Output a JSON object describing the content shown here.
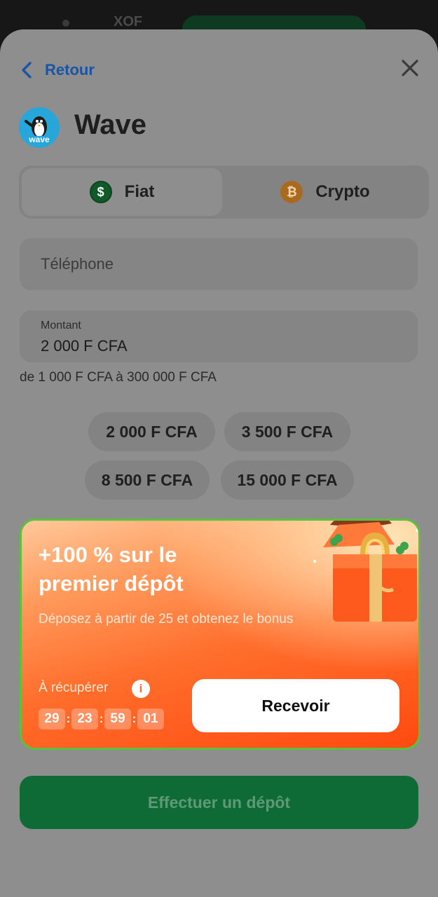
{
  "background": {
    "currency_label": "XOF"
  },
  "header": {
    "back_label": "Retour",
    "back_icon": "chevron-left-icon",
    "close_icon": "close-icon"
  },
  "method": {
    "title": "Wave",
    "logo_text": "wave"
  },
  "tabs": [
    {
      "label": "Fiat",
      "icon": "dollar-coin-icon",
      "symbol": "$",
      "selected": true
    },
    {
      "label": "Crypto",
      "icon": "bitcoin-icon",
      "symbol": "₿",
      "selected": false
    }
  ],
  "form": {
    "phone_placeholder": "Téléphone",
    "amount_label": "Montant",
    "amount_value": "2 000 F CFA",
    "range_text": "de 1 000 F CFA à 300 000 F CFA"
  },
  "presets": [
    "2 000 F CFA",
    "3 500 F CFA",
    "8 500 F CFA",
    "15 000 F CFA"
  ],
  "promo": {
    "title": "+100 % sur le premier dépôt",
    "description": "Déposez à partir de 25      et obtenez le bonus",
    "claim_label": "À récupérer",
    "info_symbol": "i",
    "timer": [
      "29",
      "23",
      "59",
      "01"
    ],
    "timer_separator": ":",
    "button_label": "Recevoir",
    "border_color": "#5cc040"
  },
  "footer": {
    "deposit_label": "Effectuer un dépôt",
    "accent": "#0f6b35"
  }
}
